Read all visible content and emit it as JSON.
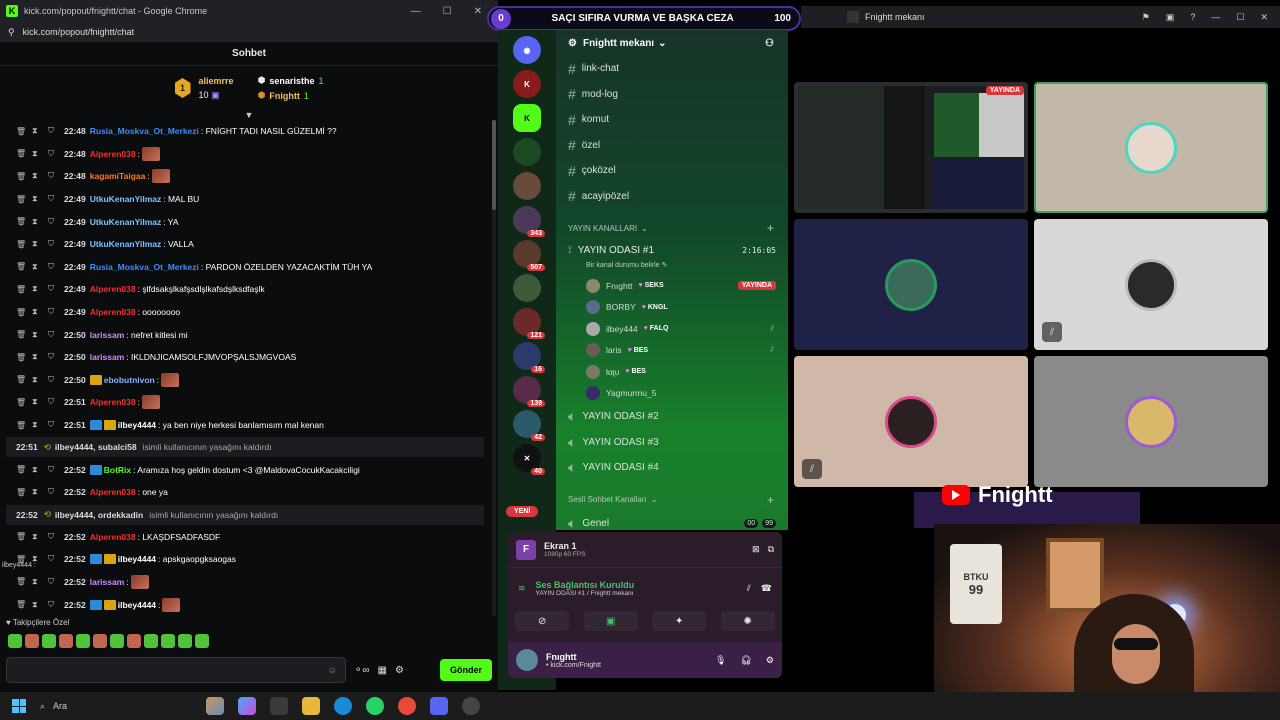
{
  "browser": {
    "title": "kick.com/popout/fnightt/chat - Google Chrome",
    "url": "kick.com/popout/fnightt/chat"
  },
  "chat": {
    "header": "Sohbet",
    "leaderboard": {
      "first": {
        "rank": "1",
        "name": "aliemrre",
        "count": "10"
      },
      "second": {
        "name": "senaristhe",
        "count": "1"
      },
      "third": {
        "name": "Fnightt",
        "count": "1"
      }
    },
    "messages": [
      {
        "time": "22:48",
        "user": "Rusia_Moskva_Ot_Merkezi",
        "color": "#3c8cff",
        "text": ": FNİGHT TADI NASIL GÜZELMİ ??",
        "emote": false,
        "sub": ""
      },
      {
        "time": "22:48",
        "user": "Alperen038",
        "color": "#ff2a2a",
        "text": ":",
        "emote": true,
        "sub": ""
      },
      {
        "time": "22:48",
        "user": "kagamiTaigaa",
        "color": "#ff7a1a",
        "text": ":",
        "emote": true,
        "sub": ""
      },
      {
        "time": "22:49",
        "user": "UtkuKenanYilmaz",
        "color": "#7dc3ff",
        "text": ": MAL BU",
        "emote": false,
        "sub": ""
      },
      {
        "time": "22:49",
        "user": "UtkuKenanYilmaz",
        "color": "#7dc3ff",
        "text": ": YA",
        "emote": false,
        "sub": ""
      },
      {
        "time": "22:49",
        "user": "UtkuKenanYilmaz",
        "color": "#7dc3ff",
        "text": ": VALLA",
        "emote": false,
        "sub": ""
      },
      {
        "time": "22:49",
        "user": "Rusia_Moskva_Ot_Merkezi",
        "color": "#3c8cff",
        "text": ": PARDON ÖZELDEN YAZACAKTİM TÜH YA",
        "emote": false,
        "sub": ""
      },
      {
        "time": "22:49",
        "user": "Alperen038",
        "color": "#ff2a2a",
        "text": ": şlfdsakşlkafşsdlşlkafsdşlksdfaşlk",
        "emote": false,
        "sub": ""
      },
      {
        "time": "22:49",
        "user": "Alperen038",
        "color": "#ff2a2a",
        "text": ": oooooooo",
        "emote": false,
        "sub": ""
      },
      {
        "time": "22:50",
        "user": "larissam",
        "color": "#d28cff",
        "text": ": nefret kitlesi mi",
        "emote": false,
        "sub": ""
      },
      {
        "time": "22:50",
        "user": "larissam",
        "color": "#d28cff",
        "text": ": IKLDNJICAMSOLFJMVOPŞALSJMGVOAS",
        "emote": false,
        "sub": ""
      },
      {
        "time": "22:50",
        "user": "ebobutnivon",
        "color": "#8fb0ff",
        "text": ":",
        "emote": true,
        "sub": "gold"
      },
      {
        "time": "22:51",
        "user": "Alperen038",
        "color": "#ff2a2a",
        "text": ":",
        "emote": true,
        "sub": ""
      },
      {
        "time": "22:51",
        "user": "ilbey4444",
        "color": "#ffffff",
        "text": ": ya ben niye herkesi banlamısım mal kenan",
        "emote": false,
        "sub": "both"
      }
    ],
    "system1": {
      "time": "22:51",
      "users": "ilbey4444, subalci58",
      "text": "isimli kullanıcının yasağını kaldırdı"
    },
    "messages2": [
      {
        "time": "22:52",
        "user": "BotRix",
        "color": "#53fc18",
        "text": ": Aramıza hoş geldin dostum <3 @MaldovaCocukKacakciligi",
        "emote": false,
        "sub": "blue"
      },
      {
        "time": "22:52",
        "user": "Alperen038",
        "color": "#ff2a2a",
        "text": ": one ya",
        "emote": false,
        "sub": ""
      }
    ],
    "system2": {
      "time": "22:52",
      "users": "ilbey4444, ordekkadin",
      "text": "isimli kullanıcının yasağını kaldırdı"
    },
    "messages3": [
      {
        "time": "22:52",
        "user": "Alperen038",
        "color": "#ff2a2a",
        "text": ": LKAŞDFSADFASDF",
        "emote": false,
        "sub": ""
      },
      {
        "time": "22:52",
        "user": "ilbey4444",
        "color": "#ffffff",
        "text": ": apskgaopgksaogas",
        "emote": false,
        "sub": "both"
      },
      {
        "time": "22:52",
        "user": "larissam",
        "color": "#d28cff",
        "text": ":",
        "emote": true,
        "sub": ""
      },
      {
        "time": "22:52",
        "user": "ilbey4444",
        "color": "#ffffff",
        "text": ":",
        "emote": true,
        "sub": "both"
      }
    ],
    "followers_label": "Takipçilere Özel",
    "send_label": "Gönder"
  },
  "banner": {
    "left": "0",
    "title": "SAÇI SIFIRA VURMA VE BAŞKA CEZA",
    "right": "100"
  },
  "discord": {
    "window_title": "Fnightt mekanı",
    "server_name": "Fnightt mekanı",
    "text_channels": [
      "link-chat",
      "mod-log",
      "komut",
      "özel",
      "çoközel",
      "acayipözel"
    ],
    "cat_voice": "YAYIN KANALLARI",
    "voice1": {
      "name": "YAYIN ODASI #1",
      "timer": "2:16:05",
      "status": "Bir kanal durumu belirle"
    },
    "voice_users": [
      {
        "name": "Fnıghtt",
        "activity": "SEKS",
        "live": "YAYINDA",
        "muted": false
      },
      {
        "name": "BORBY",
        "activity": "KNGL",
        "live": "",
        "muted": false
      },
      {
        "name": "ilbey444",
        "activity": "FALQ",
        "live": "",
        "muted": true
      },
      {
        "name": "laris",
        "activity": "BES",
        "live": "",
        "muted": true
      },
      {
        "name": "ƚαʅυ",
        "activity": "BES",
        "live": "",
        "muted": false
      },
      {
        "name": "Yagmurmu_5",
        "activity": "",
        "live": "",
        "muted": false
      }
    ],
    "other_voice": [
      "YAYIN ODASI #2",
      "YAYIN ODASI #3",
      "YAYIN ODASI #4"
    ],
    "cat_sesli": "Sesli Sohbet Kanalları",
    "genel": {
      "name": "Genel",
      "c1": "00",
      "c2": "99"
    },
    "rail_counts": [
      "343",
      "507",
      "121",
      "16",
      "139",
      "42",
      "40"
    ],
    "new_label": "YENİ",
    "screen": {
      "title": "Ekran 1",
      "sub": "1080p 60 FPS"
    },
    "conn": {
      "title": "Ses Bağlantısı Kuruldu",
      "sub": "YAYIN ODASI #1 / Fnightt mekanı"
    },
    "user": {
      "name": "Fnıghtt",
      "status": "• kick.com/Fnightt"
    },
    "live_badge": "YAYINDA"
  },
  "youtube": {
    "name": "Fnightt"
  },
  "webcam": {
    "shirt": "BTKU",
    "number": "99"
  },
  "taskbar": {
    "search": "Ara"
  },
  "overlay": {
    "small_user": "ilbey4444 :"
  }
}
